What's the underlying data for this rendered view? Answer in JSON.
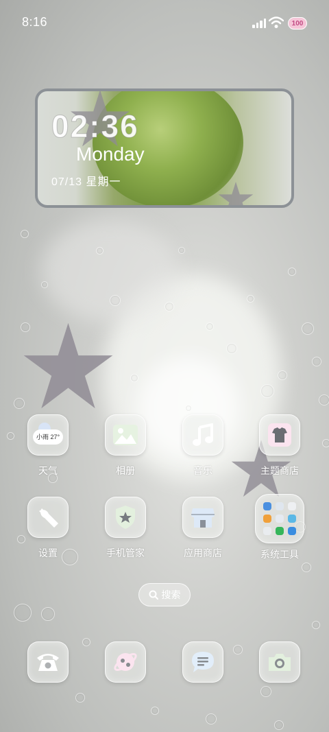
{
  "status_bar": {
    "time": "8:16",
    "battery": "100"
  },
  "clock_widget": {
    "time": "02:36",
    "day": "Monday",
    "date": "07/13  星期一"
  },
  "apps": [
    {
      "label": "天气",
      "icon": "weather-icon",
      "weather_text": "小雨 27°"
    },
    {
      "label": "相册",
      "icon": "gallery-icon"
    },
    {
      "label": "音乐",
      "icon": "music-icon"
    },
    {
      "label": "主题商店",
      "icon": "theme-store-icon"
    },
    {
      "label": "设置",
      "icon": "settings-icon"
    },
    {
      "label": "手机管家",
      "icon": "phone-manager-icon"
    },
    {
      "label": "应用商店",
      "icon": "app-store-icon"
    },
    {
      "label": "系统工具",
      "icon": "system-tools-folder-icon"
    }
  ],
  "search": {
    "label": "搜索"
  },
  "dock": [
    {
      "icon": "phone-icon"
    },
    {
      "icon": "browser-icon"
    },
    {
      "icon": "messages-icon"
    },
    {
      "icon": "camera-icon"
    }
  ],
  "colors": {
    "accent_green": "#7a9a45",
    "star": "#8f8b94",
    "battery_bg": "#f5c6d8"
  }
}
